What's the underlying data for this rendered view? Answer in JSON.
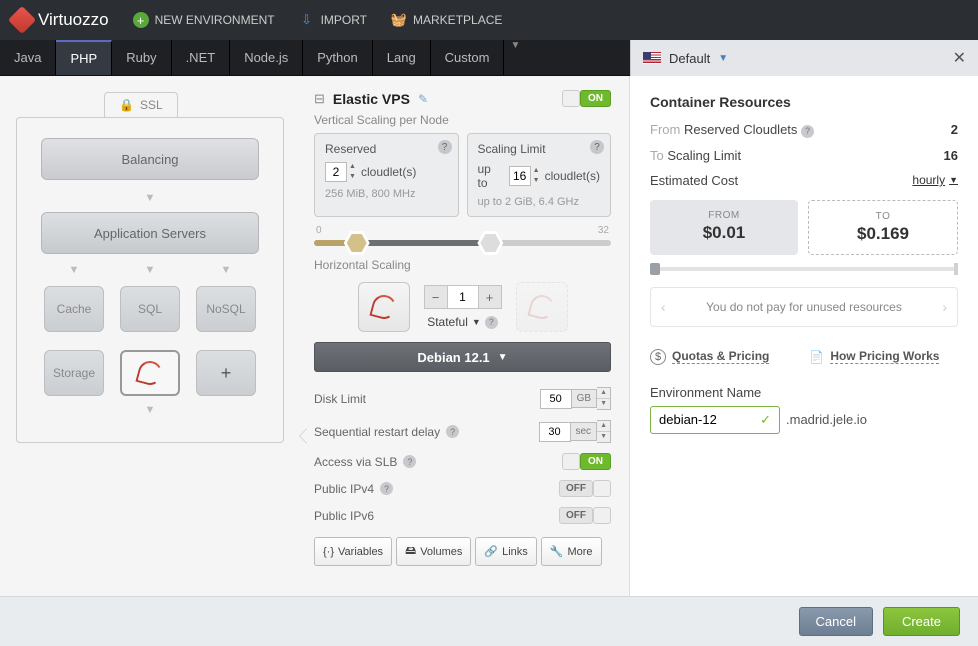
{
  "brand": "Virtuozzo",
  "top_actions": {
    "new_env": "NEW ENVIRONMENT",
    "import": "IMPORT",
    "marketplace": "MARKETPLACE"
  },
  "lang_tabs": [
    "Java",
    "PHP",
    "Ruby",
    ".NET",
    "Node.js",
    "Python",
    "Lang",
    "Custom"
  ],
  "active_lang_index": 1,
  "region": {
    "label": "Default"
  },
  "topology": {
    "ssl": "SSL",
    "balancing": "Balancing",
    "app_servers": "Application Servers",
    "cache": "Cache",
    "sql": "SQL",
    "nosql": "NoSQL",
    "storage": "Storage"
  },
  "vps": {
    "title": "Elastic VPS",
    "vscale_label": "Vertical Scaling per Node",
    "reserved": {
      "title": "Reserved",
      "value": "2",
      "unit": "cloudlet(s)",
      "sub": "256 MiB, 800 MHz"
    },
    "limit": {
      "title": "Scaling Limit",
      "prefix": "up to",
      "value": "16",
      "unit": "cloudlet(s)",
      "sub": "up to 2 GiB, 6.4 GHz"
    },
    "scale_min": "0",
    "scale_max": "32",
    "hscale_label": "Horizontal Scaling",
    "hcount": "1",
    "stateful": "Stateful",
    "os": "Debian 12.1",
    "disk": {
      "label": "Disk Limit",
      "value": "50",
      "unit": "GB"
    },
    "restart": {
      "label": "Sequential restart delay",
      "value": "30",
      "unit": "sec"
    },
    "slb": {
      "label": "Access via SLB",
      "on": "ON"
    },
    "ipv4": {
      "label": "Public IPv4",
      "state": "OFF"
    },
    "ipv6": {
      "label": "Public IPv6",
      "state": "OFF"
    },
    "buttons": {
      "vars": "Variables",
      "vols": "Volumes",
      "links": "Links",
      "more": "More"
    }
  },
  "resources": {
    "title": "Container Resources",
    "from_label": "From",
    "from_sub": "Reserved Cloudlets",
    "from_val": "2",
    "to_label": "To",
    "to_sub": "Scaling Limit",
    "to_val": "16",
    "est_label": "Estimated Cost",
    "est_mode": "hourly",
    "cost_from_cap": "FROM",
    "cost_from": "$0.01",
    "cost_to_cap": "TO",
    "cost_to": "$0.169",
    "note": "You do not pay for unused resources",
    "quotas": "Quotas & Pricing",
    "how": "How Pricing Works"
  },
  "env": {
    "label": "Environment Name",
    "name": "debian-12",
    "domain": ".madrid.jele.io"
  },
  "footer": {
    "cancel": "Cancel",
    "create": "Create"
  }
}
